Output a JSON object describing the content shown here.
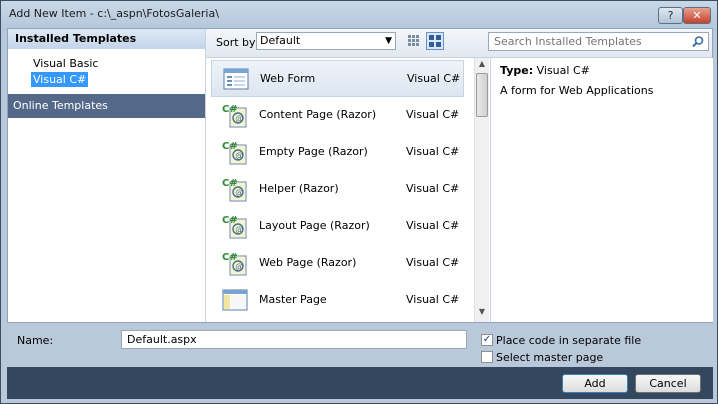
{
  "window": {
    "title": "Add New Item - c:\\_aspn\\FotosGaleria\\",
    "help_label": "?",
    "close_label": "✕"
  },
  "left_pane": {
    "installed_header": "Installed Templates",
    "tree_items": [
      "Visual Basic",
      "Visual C#"
    ],
    "selected_tree_item": "Visual C#",
    "online_header": "Online Templates"
  },
  "toolbar": {
    "sort_by_label": "Sort by:",
    "sort_value": "Default",
    "search_placeholder": "Search Installed Templates"
  },
  "templates": [
    {
      "name": "Web Form",
      "language": "Visual C#",
      "icon": "web-form-icon",
      "selected": true
    },
    {
      "name": "Content Page (Razor)",
      "language": "Visual C#",
      "icon": "razor-page-icon"
    },
    {
      "name": "Empty Page (Razor)",
      "language": "Visual C#",
      "icon": "razor-page-icon"
    },
    {
      "name": "Helper (Razor)",
      "language": "Visual C#",
      "icon": "razor-page-icon"
    },
    {
      "name": "Layout Page (Razor)",
      "language": "Visual C#",
      "icon": "razor-page-icon"
    },
    {
      "name": "Web Page (Razor)",
      "language": "Visual C#",
      "icon": "razor-page-icon"
    },
    {
      "name": "Master Page",
      "language": "Visual C#",
      "icon": "master-page-icon"
    }
  ],
  "details": {
    "type_label": "Type:",
    "type_value": "Visual C#",
    "description": "A form for Web Applications"
  },
  "bottom": {
    "name_label": "Name:",
    "name_value": "Default.aspx",
    "place_code_label": "Place code in separate file",
    "place_code_checked": true,
    "select_master_label": "Select master page",
    "select_master_checked": false
  },
  "buttons": {
    "add": "Add",
    "cancel": "Cancel"
  },
  "colors": {
    "selection": "#3399ff",
    "online_header_bg": "#54698a",
    "footer_bg": "#33475f"
  }
}
